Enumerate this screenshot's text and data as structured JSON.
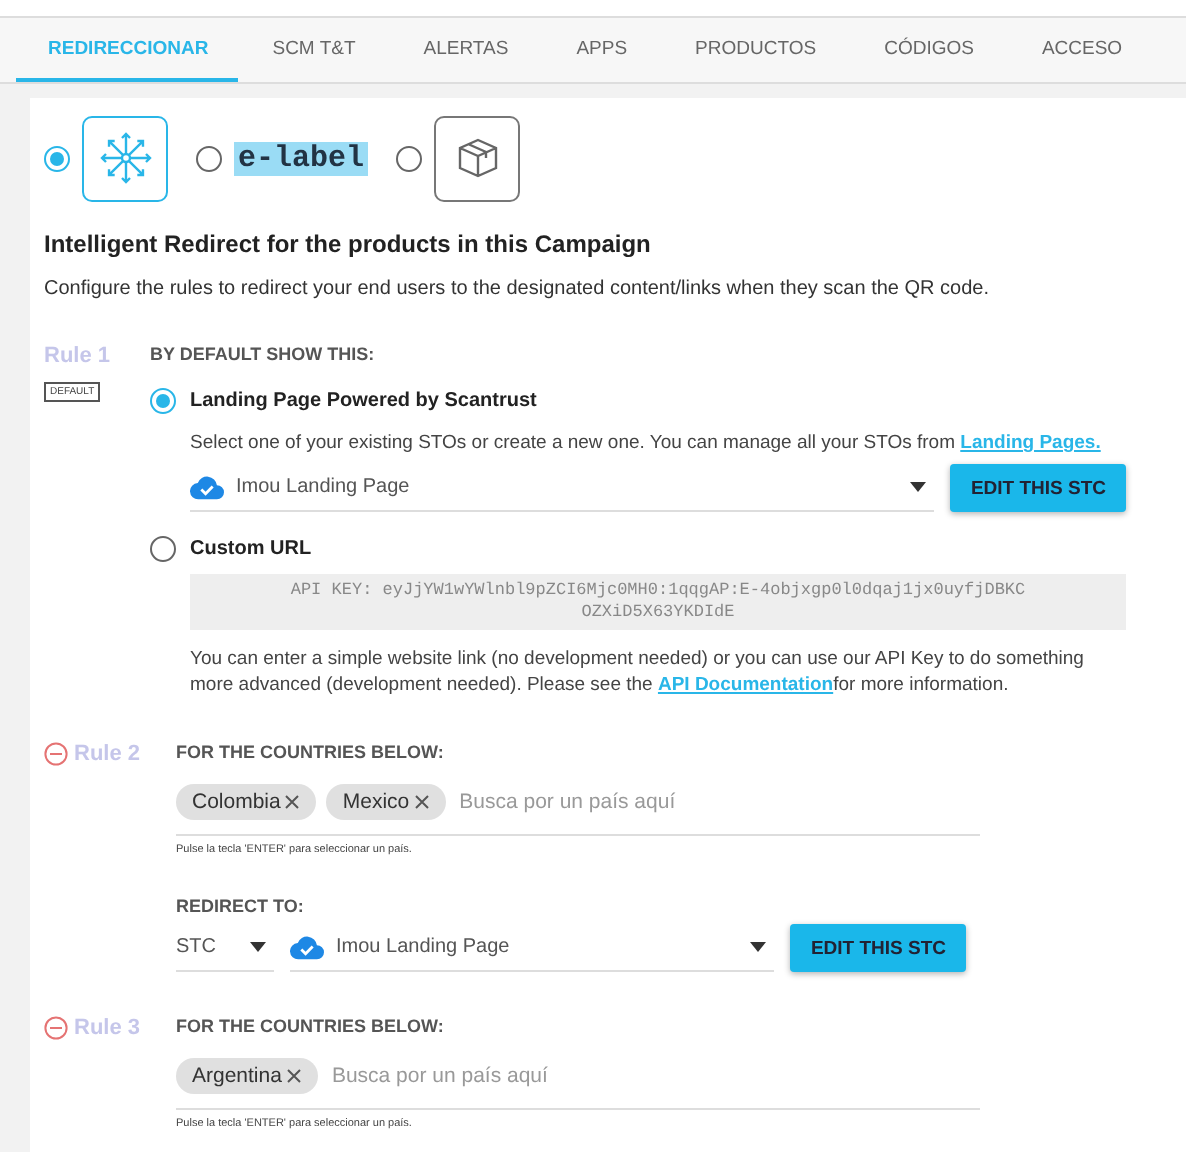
{
  "tabs": [
    {
      "label": "REDIRECCIONAR",
      "selected": true
    },
    {
      "label": "SCM T&T",
      "selected": false
    },
    {
      "label": "ALERTAS",
      "selected": false
    },
    {
      "label": "APPS",
      "selected": false
    },
    {
      "label": "PRODUCTOS",
      "selected": false
    },
    {
      "label": "CÓDIGOS",
      "selected": false
    },
    {
      "label": "ACCESO",
      "selected": false
    }
  ],
  "modes": [
    {
      "kind": "arrows",
      "selected": true
    },
    {
      "kind": "text",
      "label": "e-label",
      "selected": false
    },
    {
      "kind": "box",
      "selected": false
    }
  ],
  "heading": "Intelligent Redirect for the products in this Campaign",
  "description": "Configure the rules to redirect your end users to the designated content/links when they scan the QR code.",
  "rules": [
    {
      "kind": "default",
      "label": "Rule 1",
      "badge": "DEFAULT",
      "title": "BY DEFAULT SHOW THIS:",
      "options": [
        {
          "kind": "landing",
          "label": "Landing Page Powered by Scantrust",
          "selected": true,
          "help": "Select one of your existing STOs or create a new one. You can manage all your STOs from ",
          "link": "Landing Pages.",
          "select": "Imou Landing Page",
          "button": "EDIT THIS STC"
        },
        {
          "kind": "url",
          "label": "Custom URL",
          "selected": false,
          "api_key": "API KEY: eyJjYW1wYWlnbl9pZCI6Mjc0MH0:1qqgAP:E-4objxgp0l0dqaj1jx0uyfjDBKCOZXiD5X63YKDIdE",
          "help": "You can enter a simple website link (no development needed) or you can use our API Key to do something more advanced (development needed). Please see the ",
          "link": "API Documentation",
          "help_end": "for more information."
        }
      ]
    },
    {
      "kind": "countries",
      "label": "Rule 2",
      "title": "FOR THE COUNTRIES BELOW:",
      "chips": [
        "Colombia",
        "Mexico"
      ],
      "placeholder": "Busca por un país aquí",
      "hint": "Pulse la tecla 'ENTER' para seleccionar un país.",
      "redirect": {
        "title": "REDIRECT TO:",
        "type": "STC",
        "select": "Imou Landing Page",
        "button": "EDIT THIS STC"
      }
    },
    {
      "kind": "countries",
      "label": "Rule 3",
      "title": "FOR THE COUNTRIES BELOW:",
      "chips": [
        "Argentina"
      ],
      "placeholder": "Busca por un país aquí",
      "hint": "Pulse la tecla 'ENTER' para seleccionar un país."
    }
  ]
}
